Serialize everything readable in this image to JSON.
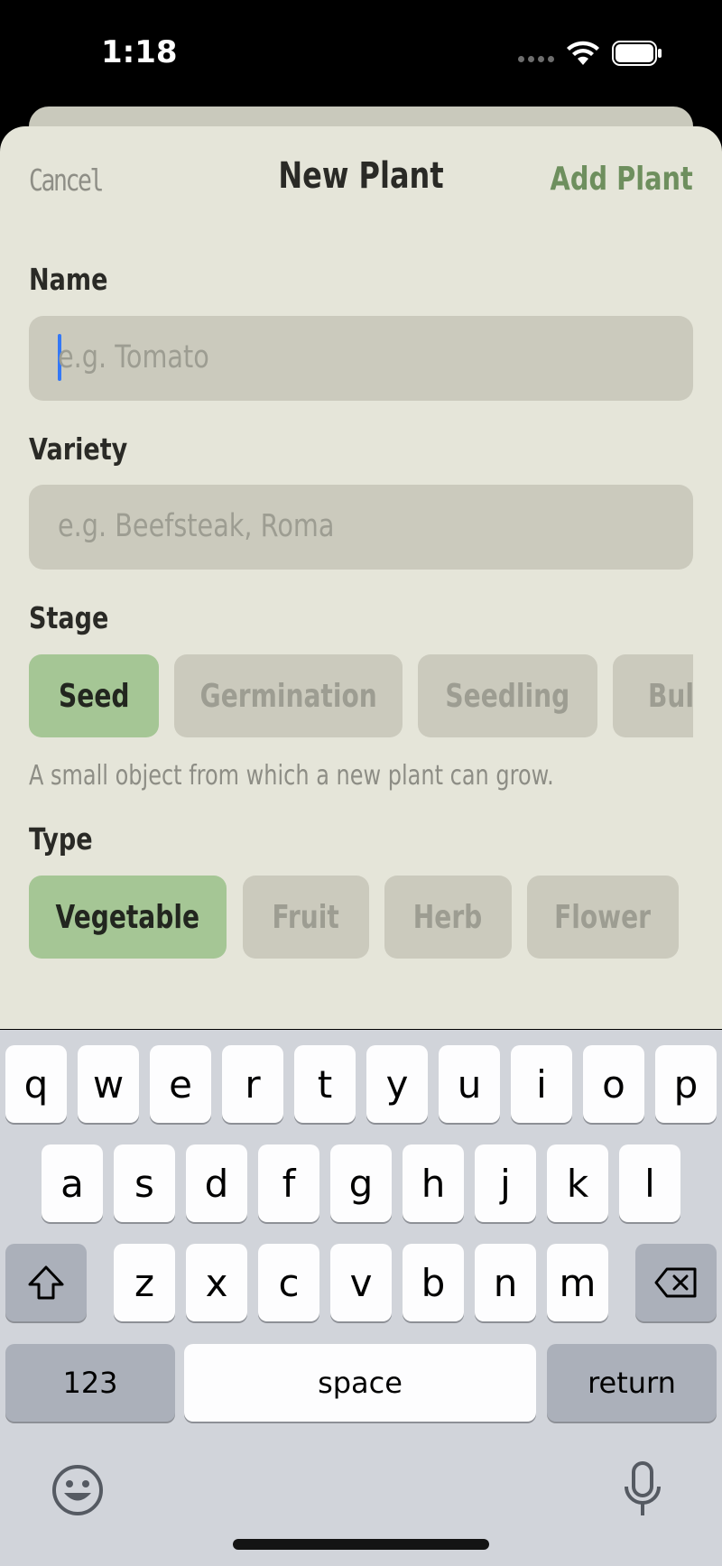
{
  "status_bar": {
    "time": "1:18",
    "icons": [
      "wifi-icon",
      "battery-icon"
    ]
  },
  "nav": {
    "cancel_label": "Cancel",
    "title": "New Plant",
    "add_label": "Add Plant"
  },
  "form": {
    "name_label": "Name",
    "name_placeholder": "e.g. Tomato",
    "variety_label": "Variety",
    "variety_placeholder": "e.g. Beefsteak, Roma",
    "stage_label": "Stage",
    "stages": [
      "Seed",
      "Germination",
      "Seedling",
      "Bulb"
    ],
    "stage_selected": "Seed",
    "stage_description": "A small object from which a new plant can grow.",
    "type_label": "Type",
    "types": [
      "Vegetable",
      "Fruit",
      "Herb",
      "Flower"
    ],
    "type_selected": "Vegetable"
  },
  "keyboard": {
    "row1": [
      "q",
      "w",
      "e",
      "r",
      "t",
      "y",
      "u",
      "i",
      "o",
      "p"
    ],
    "row2": [
      "a",
      "s",
      "d",
      "f",
      "g",
      "h",
      "j",
      "k",
      "l"
    ],
    "row3": [
      "z",
      "x",
      "c",
      "v",
      "b",
      "n",
      "m"
    ],
    "numbers_label": "123",
    "space_label": "space",
    "return_label": "return"
  },
  "colors": {
    "sheet_bg": "#e5e5d9",
    "field_bg": "#cbcabd",
    "accent_green": "#6e8f5e",
    "chip_selected": "#a5c695",
    "caret": "#3478f6"
  }
}
